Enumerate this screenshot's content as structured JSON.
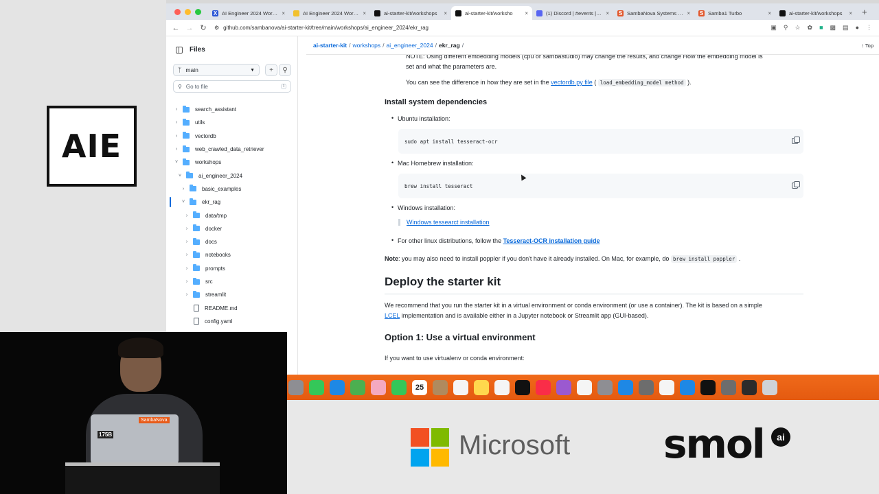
{
  "stage": {
    "logo_text": "AIE"
  },
  "browser": {
    "tabs": [
      {
        "title": "AI Engineer 2024 Worksh",
        "fav_color": "#2a55d6",
        "fav": "X"
      },
      {
        "title": "AI Engineer 2024 Worksh",
        "fav_color": "#f2c12e",
        "fav": ""
      },
      {
        "title": "ai-starter-kit/workshops",
        "fav_color": "#111111",
        "fav": ""
      },
      {
        "title": "ai-starter-kit/worksho",
        "fav_color": "#111111",
        "fav": "",
        "active": true
      },
      {
        "title": "(1) Discord | #events | Sa",
        "fav_color": "#5865f2",
        "fav": ""
      },
      {
        "title": "SambaNova Systems | Re",
        "fav_color": "#e2572c",
        "fav": "S"
      },
      {
        "title": "Samba1 Turbo",
        "fav_color": "#e2572c",
        "fav": "S"
      },
      {
        "title": "ai-starter-kit/workshops",
        "fav_color": "#111111",
        "fav": ""
      }
    ],
    "new_tab": "+",
    "url": "github.com/sambanova/ai-starter-kit/tree/main/workshops/ai_engineer_2024/ekr_rag"
  },
  "sidebar": {
    "title": "Files",
    "branch": "main",
    "search_placeholder": "Go to file",
    "shortcut": "t",
    "tree": [
      {
        "label": "search_assistant",
        "type": "folder",
        "depth": 0
      },
      {
        "label": "utils",
        "type": "folder",
        "depth": 0
      },
      {
        "label": "vectordb",
        "type": "folder",
        "depth": 0
      },
      {
        "label": "web_crawled_data_retriever",
        "type": "folder",
        "depth": 0
      },
      {
        "label": "workshops",
        "type": "folder",
        "depth": 0,
        "open": true
      },
      {
        "label": "ai_engineer_2024",
        "type": "folder",
        "depth": 1,
        "open": true
      },
      {
        "label": "basic_examples",
        "type": "folder",
        "depth": 2
      },
      {
        "label": "ekr_rag",
        "type": "folder",
        "depth": 2,
        "open": true,
        "selected": true
      },
      {
        "label": "data/tmp",
        "type": "folder",
        "depth": 3
      },
      {
        "label": "docker",
        "type": "folder",
        "depth": 3
      },
      {
        "label": "docs",
        "type": "folder",
        "depth": 3
      },
      {
        "label": "notebooks",
        "type": "folder",
        "depth": 3
      },
      {
        "label": "prompts",
        "type": "folder",
        "depth": 3
      },
      {
        "label": "src",
        "type": "folder",
        "depth": 3
      },
      {
        "label": "streamlit",
        "type": "folder",
        "depth": 3
      },
      {
        "label": "README.md",
        "type": "file",
        "depth": 3
      },
      {
        "label": "config.yaml",
        "type": "file",
        "depth": 3
      }
    ]
  },
  "breadcrumb": {
    "repo": "ai-starter-kit",
    "p1": "workshops",
    "p2": "ai_engineer_2024",
    "current": "ekr_rag",
    "top": "Top"
  },
  "readme": {
    "note_line1": "NOTE: Using different embedding models (cpu or sambastudio) may change the results, and change How the embedding model is",
    "note_line2": "set and what the parameters are.",
    "see_pre": "You can see the difference in how they are set in the",
    "see_link": "vectordb.py file",
    "see_paren_open": "(",
    "see_code": "load_embedding_model method",
    "see_paren_close": ").",
    "h_install": "Install system dependencies",
    "ubuntu": "Ubuntu installation:",
    "ubuntu_cmd": "sudo apt install tesseract-ocr",
    "mac": "Mac Homebrew installation:",
    "mac_cmd": "brew install tesseract",
    "windows": "Windows installation:",
    "windows_link": "Windows tessearct installation",
    "linux_pre": "For other linux distributions, follow the",
    "linux_link": "Tesseract-OCR installation guide",
    "note2_bold": "Note",
    "note2_text": ": you may also need to install poppler if you don't have it already installed. On Mac, for example, do",
    "note2_code": "brew install poppler",
    "note2_end": ".",
    "h_deploy": "Deploy the starter kit",
    "deploy_line1": "We recommend that you run the starter kit in a virtual environment or conda environment (or use a container). The kit is based on a simple",
    "deploy_link": "LCEL",
    "deploy_line2": "implementation and is available either in a Jupyter notebook or Streamlit app (GUI-based).",
    "h_option1": "Option 1: Use a virtual environment",
    "option1_text": "If you want to use virtualenv or conda environment:"
  },
  "dock": {
    "date": "25",
    "icons": [
      {
        "name": "launchpad-icon",
        "color": "#8e8e93"
      },
      {
        "name": "messages-icon",
        "color": "#34c759"
      },
      {
        "name": "mail-icon",
        "color": "#1e88e5"
      },
      {
        "name": "maps-icon",
        "color": "#4caf50"
      },
      {
        "name": "photos-icon",
        "color": "#f4a9c0"
      },
      {
        "name": "facetime-icon",
        "color": "#34c759"
      },
      {
        "name": "calendar-icon",
        "color": "#ffffff"
      },
      {
        "name": "contacts-icon",
        "color": "#b08a5e"
      },
      {
        "name": "reminders-icon",
        "color": "#f5f5f5"
      },
      {
        "name": "notes-icon",
        "color": "#ffd84d"
      },
      {
        "name": "freeform-icon",
        "color": "#f5f5f5"
      },
      {
        "name": "appletv-icon",
        "color": "#111111"
      },
      {
        "name": "music-icon",
        "color": "#fa2d48"
      },
      {
        "name": "podcasts-icon",
        "color": "#9b59d0"
      },
      {
        "name": "news-icon",
        "color": "#f5f5f5"
      },
      {
        "name": "settings-icon",
        "color": "#8e8e93"
      },
      {
        "name": "appstore-icon",
        "color": "#1e88e5"
      },
      {
        "name": "screenshot-icon",
        "color": "#6d6d6d"
      },
      {
        "name": "chrome-icon",
        "color": "#f5f5f5"
      },
      {
        "name": "vscode-icon",
        "color": "#1e88e5"
      },
      {
        "name": "terminal-icon",
        "color": "#111111"
      },
      {
        "name": "preview-icon",
        "color": "#6d6d6d"
      },
      {
        "name": "app-icon",
        "color": "#2b2b2b"
      },
      {
        "name": "trash-icon",
        "color": "#cfd3d8"
      }
    ]
  },
  "sponsors": {
    "microsoft": "Microsoft",
    "smol": "smol",
    "smol_badge": "ai",
    "ms_colors": [
      "#f25022",
      "#7fba00",
      "#00a4ef",
      "#ffb900"
    ]
  },
  "presenter": {
    "sticker1": "175B",
    "sticker2": "SambaNova"
  }
}
